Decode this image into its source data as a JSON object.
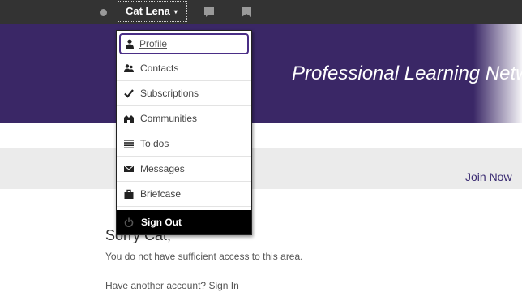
{
  "topbar": {
    "user_name": "Cat Lena",
    "caret": "▾",
    "icons": [
      "status-dot",
      "chat-icon",
      "bookmark-icon"
    ]
  },
  "banner": {
    "title": "Professional Learning Netw"
  },
  "subnav": {
    "join_label": "Join Now"
  },
  "content": {
    "heading": "Sorry Cat,",
    "message": "You do not have sufficient access to this area.",
    "another_prefix": "Have another account?",
    "signin_label": "Sign In"
  },
  "user_menu": {
    "items": [
      {
        "label": "Profile",
        "icon": "person-icon"
      },
      {
        "label": "Contacts",
        "icon": "people-icon"
      },
      {
        "label": "Subscriptions",
        "icon": "checkmark-icon"
      },
      {
        "label": "Communities",
        "icon": "community-icon"
      },
      {
        "label": "To dos",
        "icon": "list-icon"
      },
      {
        "label": "Messages",
        "icon": "envelope-icon"
      },
      {
        "label": "Briefcase",
        "icon": "briefcase-icon"
      }
    ],
    "signout_label": "Sign Out"
  },
  "colors": {
    "topbar": "#333333",
    "banner": "#3a2766",
    "accent": "#4a2e86",
    "link": "#3c2d73"
  }
}
